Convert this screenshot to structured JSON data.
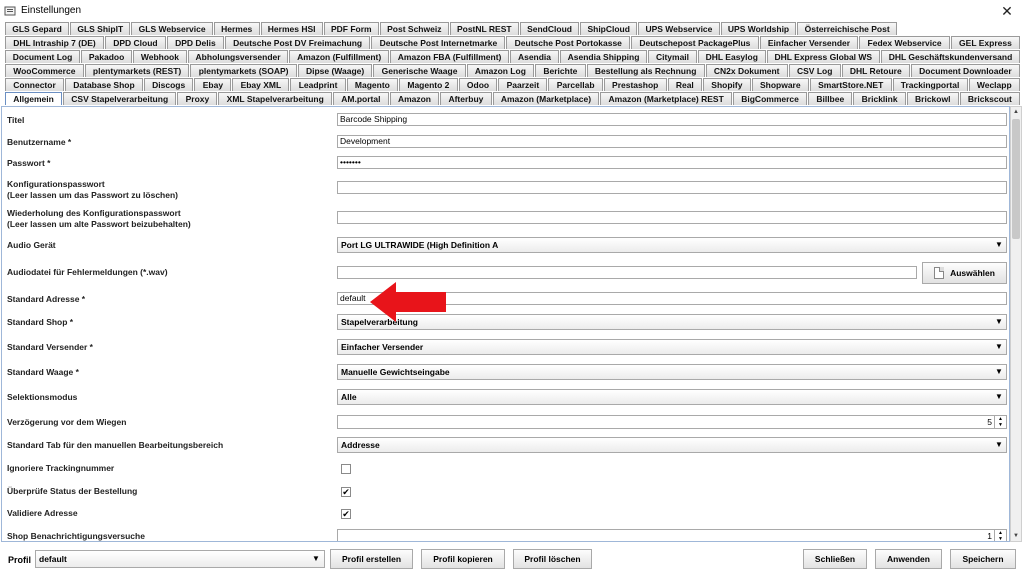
{
  "window": {
    "title": "Einstellungen",
    "close_glyph": "✕"
  },
  "tabs": {
    "row1": [
      "GLS Gepard",
      "GLS ShipIT",
      "GLS Webservice",
      "Hermes",
      "Hermes HSI",
      "PDF Form",
      "Post Schweiz",
      "PostNL REST",
      "SendCloud",
      "ShipCloud",
      "UPS Webservice",
      "UPS Worldship",
      "Österreichische Post"
    ],
    "row2": [
      "DHL Intraship 7 (DE)",
      "DPD Cloud",
      "DPD Delis",
      "Deutsche Post DV Freimachung",
      "Deutsche Post Internetmarke",
      "Deutsche Post Portokasse",
      "Deutschepost PackagePlus",
      "Einfacher Versender",
      "Fedex Webservice",
      "GEL Express"
    ],
    "row3": [
      "Document Log",
      "Pakadoo",
      "Webhook",
      "Abholungsversender",
      "Amazon (Fulfillment)",
      "Amazon FBA (Fulfillment)",
      "Asendia",
      "Asendia Shipping",
      "Citymail",
      "DHL Easylog",
      "DHL Express Global WS",
      "DHL Geschäftskundenversand"
    ],
    "row4": [
      "WooCommerce",
      "plentymarkets (REST)",
      "plentymarkets (SOAP)",
      "Dipse (Waage)",
      "Generische Waage",
      "Amazon Log",
      "Berichte",
      "Bestellung als Rechnung",
      "CN2x Dokument",
      "CSV Log",
      "DHL Retoure",
      "Document Downloader"
    ],
    "row5": [
      "Connector",
      "Database Shop",
      "Discogs",
      "Ebay",
      "Ebay XML",
      "Leadprint",
      "Magento",
      "Magento 2",
      "Odoo",
      "Paarzeit",
      "Parcellab",
      "Prestashop",
      "Real",
      "Shopify",
      "Shopware",
      "SmartStore.NET",
      "Trackingportal",
      "Weclapp"
    ],
    "row6": [
      "Allgemein",
      "CSV Stapelverarbeitung",
      "Proxy",
      "XML Stapelverarbeitung",
      "AM.portal",
      "Amazon",
      "Afterbuy",
      "Amazon (Marketplace)",
      "Amazon (Marketplace) REST",
      "BigCommerce",
      "Billbee",
      "Bricklink",
      "Brickowl",
      "Brickscout"
    ],
    "selected": "Allgemein"
  },
  "form": {
    "titel": {
      "label": "Titel",
      "value": "Barcode Shipping"
    },
    "benutzername": {
      "label": "Benutzername *",
      "value": "Development"
    },
    "passwort": {
      "label": "Passwort *",
      "value": "•••••••"
    },
    "konfig_passwort": {
      "label_line1": "Konfigurationspasswort",
      "label_line2": "(Leer lassen um das Passwort zu löschen)",
      "value": ""
    },
    "konfig_wiederholung": {
      "label_line1": "Wiederholung des Konfigurationspasswort",
      "label_line2": "(Leer lassen um alte Passwort beizubehalten)",
      "value": ""
    },
    "audio_geraet": {
      "label": "Audio Gerät",
      "value": "Port LG ULTRAWIDE (High Definition A"
    },
    "audiodatei": {
      "label": "Audiodatei für Fehlermeldungen (*.wav)",
      "value": "",
      "button": "Auswählen"
    },
    "standard_adresse": {
      "label": "Standard Adresse *",
      "value": "default"
    },
    "standard_shop": {
      "label": "Standard Shop *",
      "value": "Stapelverarbeitung"
    },
    "standard_versender": {
      "label": "Standard Versender *",
      "value": "Einfacher Versender"
    },
    "standard_waage": {
      "label": "Standard Waage *",
      "value": "Manuelle Gewichtseingabe"
    },
    "selektionsmodus": {
      "label": "Selektionsmodus",
      "value": "Alle"
    },
    "verzoegerung": {
      "label": "Verzögerung vor dem Wiegen",
      "value": "5"
    },
    "standard_tab": {
      "label": "Standard Tab für den manuellen Bearbeitungsbereich",
      "value": "Addresse"
    },
    "ignoriere_tracking": {
      "label": "Ignoriere Trackingnummer",
      "checked": false
    },
    "pruefe_status": {
      "label": "Überprüfe Status der Bestellung",
      "checked": true,
      "mark": "✔"
    },
    "validiere_adresse": {
      "label": "Validiere Adresse",
      "checked": true,
      "mark": "✔"
    },
    "shop_benachrichtigung": {
      "label": "Shop Benachrichtigungsversuche",
      "value": "1"
    }
  },
  "bottom": {
    "profil_label": "Profil",
    "profil_value": "default",
    "profil_erstellen": "Profil erstellen",
    "profil_kopieren": "Profil kopieren",
    "profil_loeschen": "Profil löschen",
    "schliessen": "Schließen",
    "anwenden": "Anwenden",
    "speichern": "Speichern"
  },
  "colors": {
    "arrow": "#e8141a",
    "selected_tab_border": "#6b8fc2"
  }
}
